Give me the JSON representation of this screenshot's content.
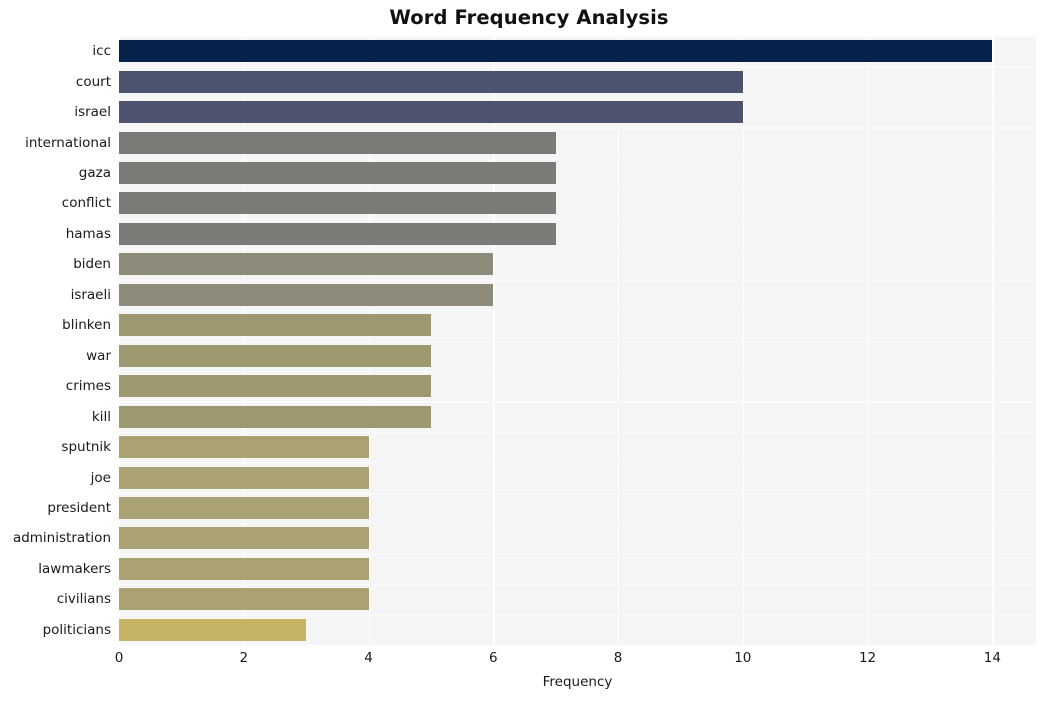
{
  "chart_data": {
    "type": "bar",
    "orientation": "horizontal",
    "title": "Word Frequency Analysis",
    "xlabel": "Frequency",
    "ylabel": "",
    "categories": [
      "icc",
      "court",
      "israel",
      "international",
      "gaza",
      "conflict",
      "hamas",
      "biden",
      "israeli",
      "blinken",
      "war",
      "crimes",
      "kill",
      "sputnik",
      "joe",
      "president",
      "administration",
      "lawmakers",
      "civilians",
      "politicians"
    ],
    "values": [
      14,
      10,
      10,
      7,
      7,
      7,
      7,
      6,
      6,
      5,
      5,
      5,
      5,
      4,
      4,
      4,
      4,
      4,
      4,
      3
    ],
    "xlim": [
      0,
      14.7
    ],
    "xticks": [
      0,
      2,
      4,
      6,
      8,
      10,
      12,
      14
    ],
    "xtick_labels": [
      "0",
      "2",
      "4",
      "6",
      "8",
      "10",
      "12",
      "14"
    ],
    "grid": true,
    "legend": false,
    "bar_colors": [
      "#05224a",
      "#4c536e",
      "#4e5470",
      "#7b7a76",
      "#7b7a76",
      "#7b7a76",
      "#7b7a76",
      "#8d8a7a",
      "#8e8b7b",
      "#9e9870",
      "#9e9870",
      "#9e9870",
      "#9e9870",
      "#aba274",
      "#aba274",
      "#aba274",
      "#aba274",
      "#aba274",
      "#aba274",
      "#c4b464"
    ],
    "style": {
      "plot_background": "#f5f5f5",
      "figure_background": "#ffffff",
      "gridline_color": "#ffffff",
      "text_color": "#1a1a1a"
    }
  }
}
